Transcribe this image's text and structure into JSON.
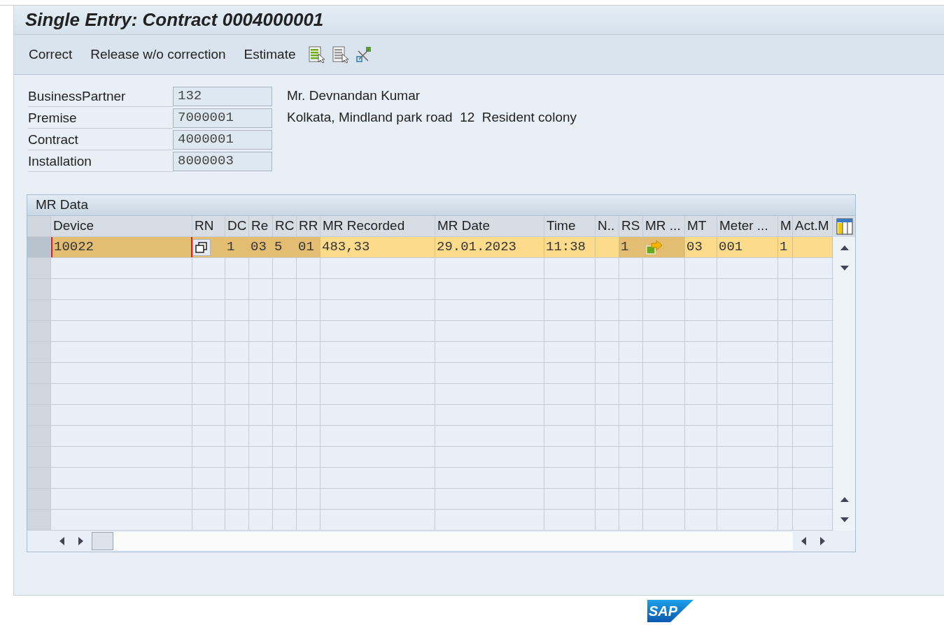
{
  "window": {
    "title": "Single Entry: Contract 0004000001"
  },
  "toolbar": {
    "buttons": [
      "Correct",
      "Release w/o correction",
      "Estimate"
    ]
  },
  "form": {
    "fields": [
      {
        "label": "BusinessPartner",
        "value": "132",
        "description": "Mr. Devnandan Kumar"
      },
      {
        "label": "Premise",
        "value": "7000001",
        "description": "Kolkata, Mindland park road  12  Resident colony"
      },
      {
        "label": "Contract",
        "value": "4000001"
      },
      {
        "label": "Installation",
        "value": "8000003"
      }
    ]
  },
  "table": {
    "title": "MR Data",
    "columns": [
      {
        "label": "Device",
        "key": true
      },
      {
        "label": "RN",
        "key": true
      },
      {
        "label": "DC",
        "key": true
      },
      {
        "label": "Re",
        "key": true
      },
      {
        "label": "RC",
        "key": true
      },
      {
        "label": "RR",
        "key": true
      },
      {
        "label": "MR Recorded",
        "key": false
      },
      {
        "label": "MR Date",
        "key": false
      },
      {
        "label": "Time",
        "key": false
      },
      {
        "label": "N..",
        "key": false
      },
      {
        "label": "RS",
        "key": true
      },
      {
        "label": "MR ...",
        "key": true
      },
      {
        "label": "MT",
        "key": false
      },
      {
        "label": "Meter ...",
        "key": false
      },
      {
        "label": "M",
        "key": false
      },
      {
        "label": "Act.M",
        "key": false
      }
    ],
    "rows": [
      {
        "selected": true,
        "cells": [
          {
            "kind": "text",
            "value": "10022",
            "focused": true
          },
          {
            "kind": "button"
          },
          {
            "kind": "text",
            "value": "1",
            "focused": false
          },
          {
            "kind": "text",
            "value": "03",
            "focused": false
          },
          {
            "kind": "text",
            "value": "5",
            "focused": false
          },
          {
            "kind": "text",
            "value": "01",
            "focused": false
          },
          {
            "kind": "text",
            "value": "483,33",
            "focused": false
          },
          {
            "kind": "text",
            "value": "29.01.2023",
            "focused": false
          },
          {
            "kind": "text",
            "value": "11:38",
            "focused": false
          },
          {
            "kind": "empty"
          },
          {
            "kind": "text",
            "value": "1",
            "focused": false
          },
          {
            "kind": "icon"
          },
          {
            "kind": "text",
            "value": "03",
            "focused": false
          },
          {
            "kind": "text",
            "value": "001",
            "focused": false
          },
          {
            "kind": "text",
            "value": "1",
            "focused": false
          },
          {
            "kind": "empty"
          }
        ]
      }
    ]
  },
  "logo": {
    "text": "SAP"
  }
}
